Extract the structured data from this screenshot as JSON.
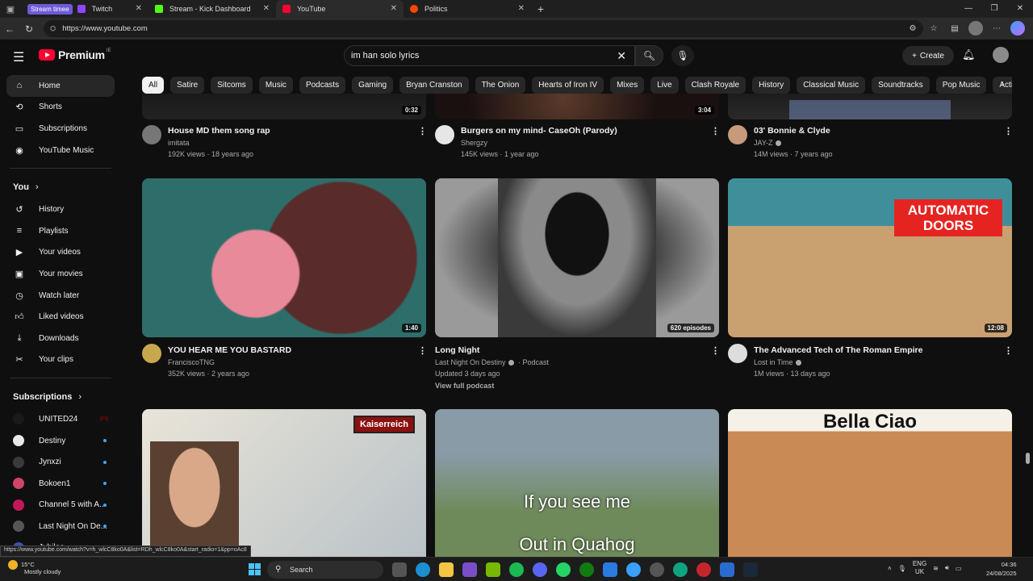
{
  "browser": {
    "tabs": [
      {
        "group": "Stream timee",
        "label": "Twitch",
        "color": "#9146ff"
      },
      {
        "label": "Stream - Kick Dashboard",
        "color": "#53fc18"
      },
      {
        "label": "YouTube",
        "color": "#ff0033",
        "active": true
      },
      {
        "label": "Politics",
        "color": "#ff4500"
      }
    ],
    "url": "https://www.youtube.com",
    "status_url": "https://www.youtube.com/watch?v=h_wlcC8ko0A&list=RDh_wlcC8ko0A&start_radio=1&pp=oAc8"
  },
  "header": {
    "logo_text": "Premium",
    "logo_country": "IE",
    "search_value": "im han solo lyrics",
    "create_label": "Create"
  },
  "chips": [
    "All",
    "Satire",
    "Sitcoms",
    "Music",
    "Podcasts",
    "Gaming",
    "Bryan Cranston",
    "The Onion",
    "Hearts of Iron IV",
    "Mixes",
    "Live",
    "Clash Royale",
    "History",
    "Classical Music",
    "Soundtracks",
    "Pop Music",
    "Action-adv"
  ],
  "sidebar": {
    "main": [
      {
        "label": "Home",
        "icon": "home-icon"
      },
      {
        "label": "Shorts",
        "icon": "shorts-icon"
      },
      {
        "label": "Subscriptions",
        "icon": "subscriptions-icon"
      },
      {
        "label": "YouTube Music",
        "icon": "youtube-music-icon"
      }
    ],
    "you_label": "You",
    "you": [
      {
        "label": "History",
        "icon": "history-icon"
      },
      {
        "label": "Playlists",
        "icon": "playlists-icon"
      },
      {
        "label": "Your videos",
        "icon": "your-videos-icon"
      },
      {
        "label": "Your movies",
        "icon": "movies-icon"
      },
      {
        "label": "Watch later",
        "icon": "watch-later-icon"
      },
      {
        "label": "Liked videos",
        "icon": "like-icon"
      },
      {
        "label": "Downloads",
        "icon": "download-icon"
      },
      {
        "label": "Your clips",
        "icon": "clips-icon"
      }
    ],
    "subs_label": "Subscriptions",
    "subs": [
      {
        "label": "UNITED24",
        "color": "#1a1a1a",
        "live": true
      },
      {
        "label": "Destiny",
        "color": "#e8e8e8"
      },
      {
        "label": "Jynxzi",
        "color": "#3a3a3a"
      },
      {
        "label": "Bokoen1",
        "color": "#d04466"
      },
      {
        "label": "Channel 5 with A...",
        "color": "#c2185b"
      },
      {
        "label": "Last Night On De...",
        "color": "#555"
      },
      {
        "label": "Jubilee",
        "color": "#3f51b5"
      }
    ]
  },
  "videos_row0": [
    {
      "title": "House MD them song rap",
      "channel": "imitata",
      "meta": "192K views · 18 years ago",
      "duration": "0:32"
    },
    {
      "title": "Burgers on my mind- CaseOh (Parody)",
      "channel": "Shergzy",
      "meta": "145K views · 1 year ago",
      "duration": "3:04"
    },
    {
      "title": "03' Bonnie & Clyde",
      "channel": "JAY-Z",
      "meta": "14M views · 7 years ago"
    }
  ],
  "videos_row1": [
    {
      "title": "YOU HEAR ME YOU BASTARD",
      "channel": "FranciscoTNG",
      "meta": "352K views · 2 years ago",
      "duration": "1:40"
    },
    {
      "title": "Long Night",
      "channel": "Last Night On Destiny",
      "channel_extra": "· Podcast",
      "meta": "Updated 3 days ago",
      "extra_link": "View full podcast",
      "duration": "620 episodes"
    },
    {
      "title": "The Advanced Tech of The Roman Empire",
      "channel": "Lost in Time",
      "meta": "1M views · 13 days ago",
      "duration": "12:08",
      "thumb_text": "AUTOMATIC DOORS"
    }
  ],
  "videos_row2": [
    {
      "thumb_text": "Kaiserreich"
    },
    {
      "thumb_text_1": "If you see me",
      "thumb_text_2": "Out in Quahog"
    },
    {
      "thumb_text": "Bella Ciao"
    }
  ],
  "taskbar": {
    "temp": "15°C",
    "weather": "Mostly cloudy",
    "search": "Search",
    "lang1": "ENG",
    "lang2": "UK",
    "time": "04:36",
    "date": "24/08/2025"
  }
}
